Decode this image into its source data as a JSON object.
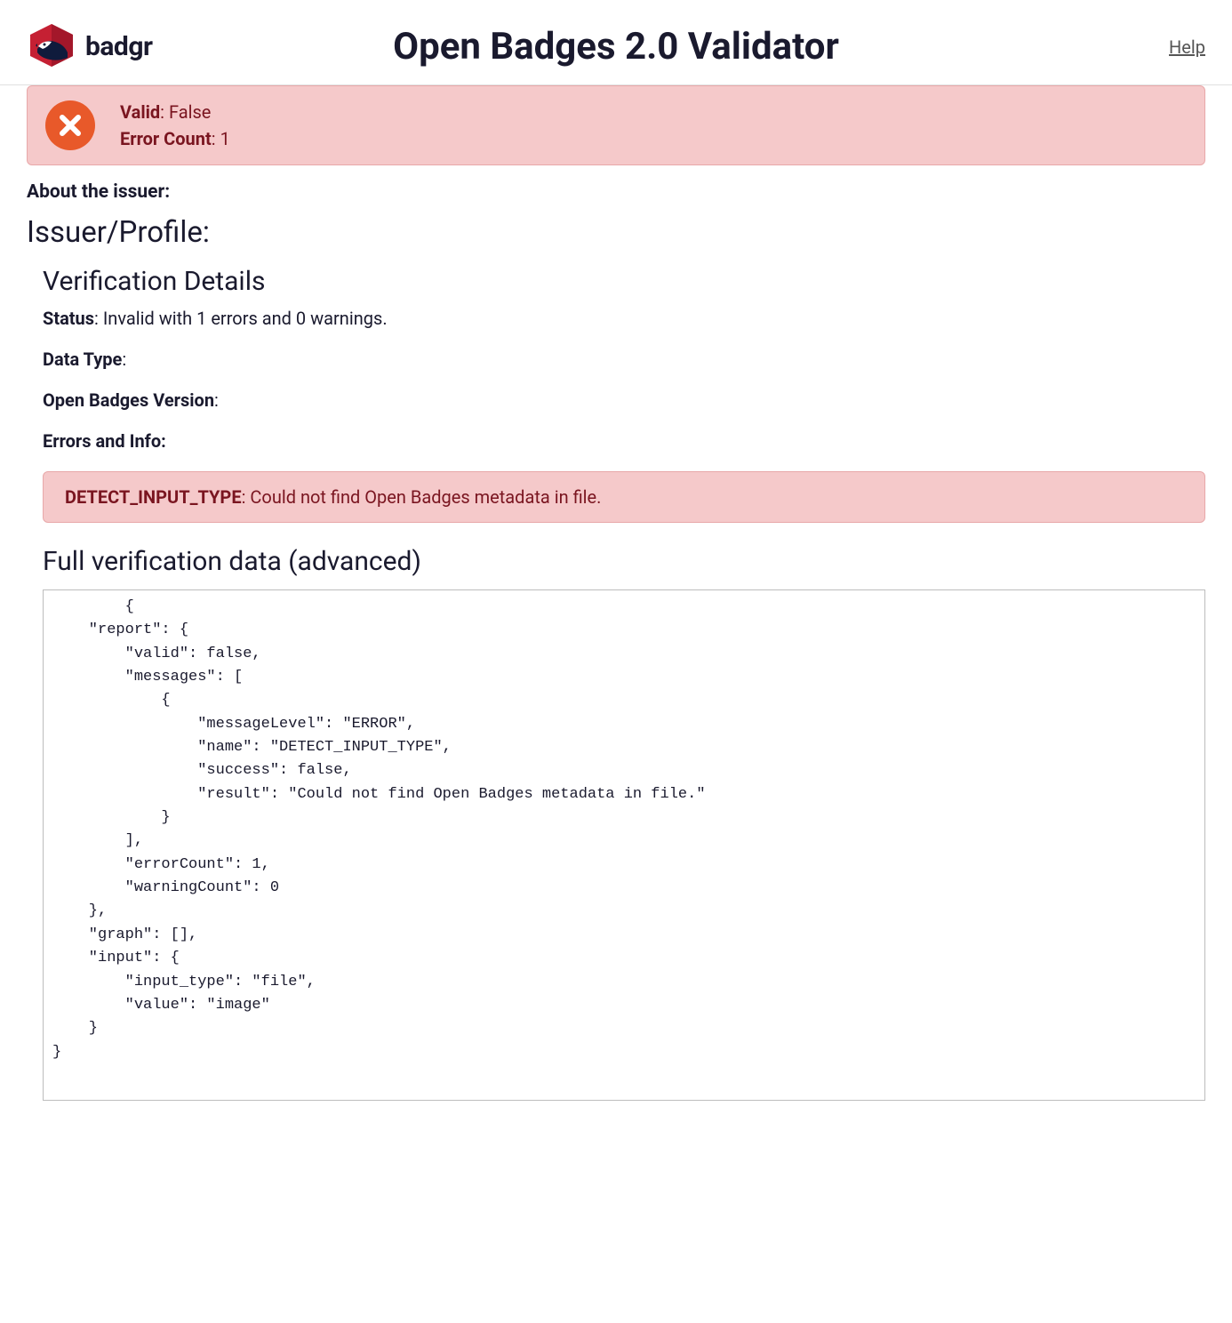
{
  "header": {
    "logo_text": "badgr",
    "page_title": "Open Badges 2.0 Validator",
    "help_label": "Help"
  },
  "alert": {
    "valid_label": "Valid",
    "valid_value": "False",
    "error_count_label": "Error Count",
    "error_count_value": "1"
  },
  "about": {
    "heading": "About the issuer:",
    "issuer_heading": "Issuer/Profile:"
  },
  "verification": {
    "heading": "Verification Details",
    "status_label": "Status",
    "status_value": "Invalid with 1 errors and 0 warnings.",
    "data_type_label": "Data Type",
    "data_type_value": "",
    "ob_version_label": "Open Badges Version",
    "ob_version_value": "",
    "errors_info_label": "Errors and Info:"
  },
  "error_box": {
    "name": "DETECT_INPUT_TYPE",
    "message": "Could not find Open Badges metadata in file."
  },
  "advanced": {
    "heading": "Full verification data (advanced)",
    "code": "        {\n    \"report\": {\n        \"valid\": false,\n        \"messages\": [\n            {\n                \"messageLevel\": \"ERROR\",\n                \"name\": \"DETECT_INPUT_TYPE\",\n                \"success\": false,\n                \"result\": \"Could not find Open Badges metadata in file.\"\n            }\n        ],\n        \"errorCount\": 1,\n        \"warningCount\": 0\n    },\n    \"graph\": [],\n    \"input\": {\n        \"input_type\": \"file\",\n        \"value\": \"image\"\n    }\n}"
  }
}
